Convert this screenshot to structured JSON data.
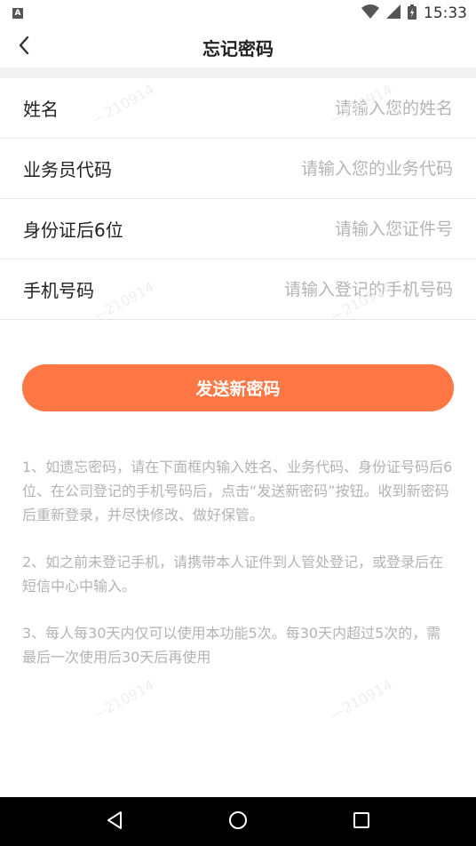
{
  "status_bar": {
    "notification_icon": "A",
    "time": "15:33",
    "icons": [
      "wifi-icon",
      "signal-icon",
      "battery-icon"
    ]
  },
  "header": {
    "title": "忘记密码",
    "back_icon": "chevron-left-icon"
  },
  "form": {
    "fields": [
      {
        "label": "姓名",
        "placeholder": "请输入您的姓名",
        "value": ""
      },
      {
        "label": "业务员代码",
        "placeholder": "请输入您的业务代码",
        "value": ""
      },
      {
        "label": "身份证后6位",
        "placeholder": "请输入您证件号",
        "value": ""
      },
      {
        "label": "手机号码",
        "placeholder": "请输入登记的手机号码",
        "value": ""
      }
    ],
    "submit_label": "发送新密码"
  },
  "notes": [
    "1、如遗忘密码，请在下面框内输入姓名、业务代码、身份证号码后6位、在公司登记的手机号码后，点击“发送新密码”按钮。收到新密码后重新登录，并尽快修改、做好保管。",
    "2、如之前未登记手机，请携带本人证件到人管处登记，或登录后在短信中心中输入。",
    "3、每人每30天内仅可以使用本功能5次。每30天内超过5次的，需最后一次使用后30天后再使用"
  ],
  "watermark": "—210914",
  "colors": {
    "accent": "#ff7744",
    "placeholder": "#b5b5b5",
    "note_text": "#b3b3b3"
  },
  "nav_bar": {
    "icons": [
      "back-triangle-icon",
      "home-circle-icon",
      "recents-square-icon"
    ]
  }
}
